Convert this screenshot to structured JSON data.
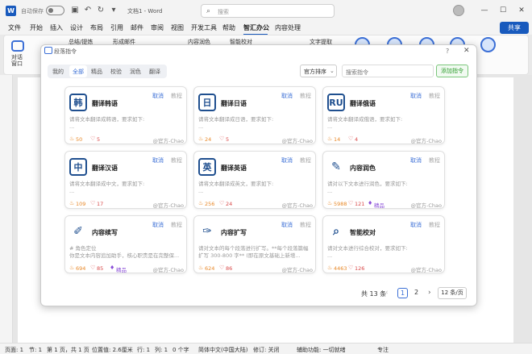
{
  "titlebar": {
    "autosave_label": "自动保存",
    "doc_title": "文档1 - Word",
    "search_placeholder": "搜索"
  },
  "menu": [
    "文件",
    "开始",
    "插入",
    "设计",
    "布局",
    "引用",
    "邮件",
    "审阅",
    "视图",
    "开发工具",
    "帮助",
    "智汇办公",
    "内容处理"
  ],
  "active_menu": "智汇办公",
  "share_label": "共享",
  "ribbon": {
    "robot_label": "对话\n窗口",
    "items": [
      "总结/提炼",
      "形成邮件",
      "内容润色",
      "智能校对",
      "文字提取"
    ]
  },
  "dialog": {
    "title": "段落指令",
    "help": "?",
    "close": "✕",
    "tabs": [
      "我的",
      "全部",
      "精品",
      "校验",
      "润色",
      "翻译"
    ],
    "active_tab": "全部",
    "sort_label": "官方排序",
    "filter_placeholder": "搜索指令",
    "add_label": "添加指令",
    "cards": [
      {
        "icon": "韩",
        "icon_name": "korean-translate-icon",
        "title": "翻译韩语",
        "cancel": "取消",
        "tutorial": "教程",
        "desc": "请将文本翻译成韩语，要求如下:",
        "desc2": "...",
        "likes": "50",
        "hearts": "5",
        "author": "@官方-Chao"
      },
      {
        "icon": "日",
        "icon_name": "japanese-translate-icon",
        "title": "翻译日语",
        "cancel": "取消",
        "tutorial": "教程",
        "desc": "请将文本翻译成日语，要求如下:",
        "desc2": "...",
        "likes": "24",
        "hearts": "5",
        "author": "@官方-Chao"
      },
      {
        "icon": "RU",
        "icon_name": "russian-translate-icon",
        "title": "翻译俄语",
        "cancel": "取消",
        "tutorial": "教程",
        "desc": "请将文本翻译成俄语，要求如下:",
        "desc2": "...",
        "likes": "14",
        "hearts": "4",
        "author": "@官方-Chao"
      },
      {
        "icon": "中",
        "icon_name": "chinese-translate-icon",
        "title": "翻译汉语",
        "cancel": "取消",
        "tutorial": "教程",
        "desc": "请将文本翻译成中文，要求如下:",
        "desc2": "...",
        "likes": "109",
        "hearts": "17",
        "author": "@官方-Chao"
      },
      {
        "icon": "英",
        "icon_name": "english-translate-icon",
        "title": "翻译英语",
        "cancel": "取消",
        "tutorial": "教程",
        "desc": "请将文本翻译成英文，要求如下:",
        "desc2": "...",
        "likes": "256",
        "hearts": "24",
        "author": "@官方-Chao"
      },
      {
        "icon": "✎",
        "icon_name": "polish-icon",
        "title": "内容润色",
        "cancel": "取消",
        "tutorial": "教程",
        "desc": "请对以下文本进行润色，要求如下:",
        "desc2": "...",
        "likes": "5988",
        "hearts": "121",
        "gem": "精品",
        "author": "@官方-Chao"
      },
      {
        "icon": "✐",
        "icon_name": "continue-writing-icon",
        "title": "内容续写",
        "cancel": "取消",
        "tutorial": "教程",
        "desc": "# 角色定位",
        "desc2": "你是文本内容追加助手，核心职责是在完整保...",
        "likes": "694",
        "hearts": "85",
        "gem": "精品",
        "author": "@官方-Chao"
      },
      {
        "icon": "✑",
        "icon_name": "expand-icon",
        "title": "内容扩写",
        "cancel": "取消",
        "tutorial": "教程",
        "desc": "请对文本的每个段落进行扩写。**每个段落篇幅扩写 300-800 字** (即在原文基础上新增...",
        "desc2": "",
        "likes": "624",
        "hearts": "86",
        "author": "@官方-Chao"
      },
      {
        "icon": "⌕",
        "icon_name": "proofread-icon",
        "title": "智能校对",
        "cancel": "取消",
        "tutorial": "教程",
        "desc": "请对文本进行综合校对，要求如下:",
        "desc2": "...",
        "likes": "4463",
        "hearts": "126",
        "author": "@官方-Chao"
      }
    ],
    "pager": {
      "total": "共 13 条",
      "pages": [
        "1",
        "2"
      ],
      "active": "1",
      "page_size": "12 条/页"
    }
  },
  "status": [
    "页面: 1",
    "节: 1",
    "第 1 页，共 1 页",
    "位置值: 2.6厘米",
    "行: 1",
    "列: 1",
    "0 个字",
    "简体中文(中国大陆)",
    "修订: 关闭",
    "辅助功能: 一切就绪",
    "专注"
  ]
}
